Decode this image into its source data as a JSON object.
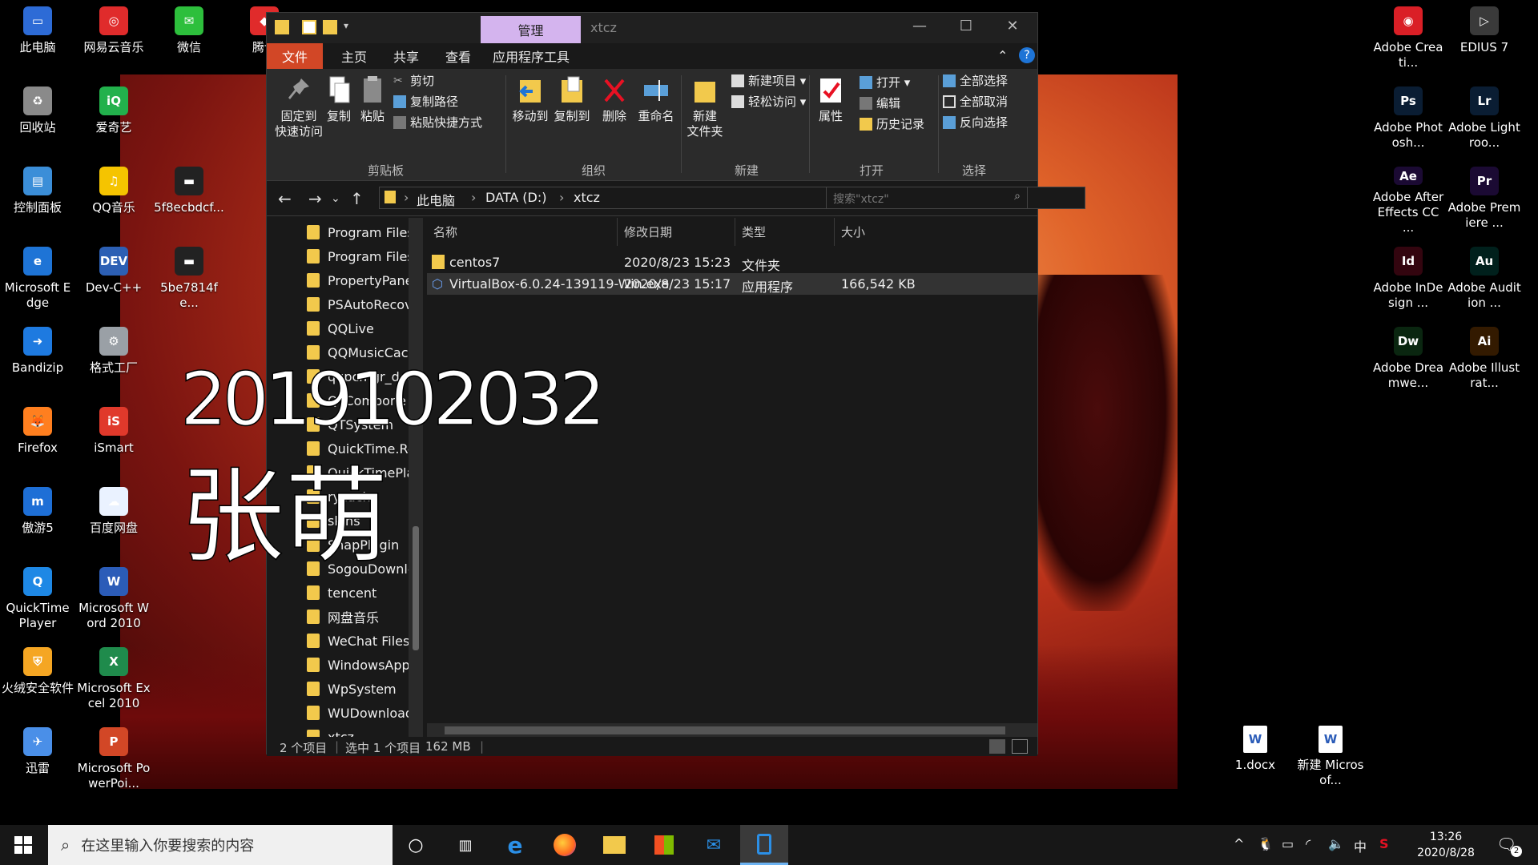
{
  "desktop": {
    "left_icons": [
      {
        "label": "此电脑",
        "icon": "computer-icon",
        "color": "#2d6bd6",
        "glyph": "▭"
      },
      {
        "label": "网易云音乐",
        "icon": "netease-music-icon",
        "color": "#e02b2b",
        "glyph": "◎"
      },
      {
        "label": "微信",
        "icon": "wechat-icon",
        "color": "#2dbf3c",
        "glyph": "✉"
      },
      {
        "label": "腾讯",
        "icon": "tencent-icon",
        "color": "#e02b2b",
        "glyph": "◆"
      },
      {
        "label": "回收站",
        "icon": "recycle-bin-icon",
        "color": "#8a8a8a",
        "glyph": "♻"
      },
      {
        "label": "爱奇艺",
        "icon": "iqiyi-icon",
        "color": "#22b14c",
        "glyph": "iQ"
      },
      {
        "label": "控制面板",
        "icon": "control-panel-icon",
        "color": "#3b8ed8",
        "glyph": "▤"
      },
      {
        "label": "QQ音乐",
        "icon": "qq-music-icon",
        "color": "#f5c400",
        "glyph": "♫"
      },
      {
        "label": "5f8ecbdcf...",
        "icon": "image-file-icon",
        "color": "#222222",
        "glyph": "▬"
      },
      {
        "label": "Microsoft Edge",
        "icon": "edge-icon",
        "color": "#1e74d6",
        "glyph": "e"
      },
      {
        "label": "Dev-C++",
        "icon": "devcpp-icon",
        "color": "#2c5fb4",
        "glyph": "DEV"
      },
      {
        "label": "5be7814fe...",
        "icon": "image-file-icon",
        "color": "#222222",
        "glyph": "▬"
      },
      {
        "label": "Bandizip",
        "icon": "bandizip-icon",
        "color": "#1e7ae0",
        "glyph": "➜"
      },
      {
        "label": "格式工厂",
        "icon": "format-factory-icon",
        "color": "#9aa0a6",
        "glyph": "⚙"
      },
      {
        "label": "Firefox",
        "icon": "firefox-icon",
        "color": "#ff7f1f",
        "glyph": "🦊"
      },
      {
        "label": "iSmart",
        "icon": "ismart-icon",
        "color": "#e0392b",
        "glyph": "iS"
      },
      {
        "label": "傲游5",
        "icon": "maxthon-icon",
        "color": "#1e6fd6",
        "glyph": "m"
      },
      {
        "label": "百度网盘",
        "icon": "baidu-netdisk-icon",
        "color": "#eaf2ff",
        "glyph": "☁"
      },
      {
        "label": "QuickTime Player",
        "icon": "quicktime-icon",
        "color": "#1e88e5",
        "glyph": "Q"
      },
      {
        "label": "Microsoft Word 2010",
        "icon": "word-icon",
        "color": "#2b5cb8",
        "glyph": "W"
      },
      {
        "label": "火绒安全软件",
        "icon": "huorong-icon",
        "color": "#f5a623",
        "glyph": "⛨"
      },
      {
        "label": "Microsoft Excel 2010",
        "icon": "excel-icon",
        "color": "#1f8b4c",
        "glyph": "X"
      },
      {
        "label": "迅雷",
        "icon": "xunlei-icon",
        "color": "#4a8fe8",
        "glyph": "✈"
      },
      {
        "label": "Microsoft PowerPoi...",
        "icon": "powerpoint-icon",
        "color": "#d24726",
        "glyph": "P"
      }
    ],
    "right_icons": [
      {
        "label": "Adobe Creati...",
        "icon": "adobe-cc-icon",
        "color": "#da1f26",
        "glyph": "◉"
      },
      {
        "label": "EDIUS 7",
        "icon": "edius-icon",
        "color": "#3a3a3a",
        "glyph": "▷"
      },
      {
        "label": "Adobe Photosh...",
        "icon": "photoshop-icon",
        "color": "#0a1d33",
        "glyph": "Ps"
      },
      {
        "label": "Adobe Lightroo...",
        "icon": "lightroom-icon",
        "color": "#0a1d33",
        "glyph": "Lr"
      },
      {
        "label": "Adobe After Effects CC ...",
        "icon": "after-effects-icon",
        "color": "#1b0a33",
        "glyph": "Ae"
      },
      {
        "label": "Adobe Premiere ...",
        "icon": "premiere-icon",
        "color": "#1b0a33",
        "glyph": "Pr"
      },
      {
        "label": "Adobe InDesign ...",
        "icon": "indesign-icon",
        "color": "#33050f",
        "glyph": "Id"
      },
      {
        "label": "Adobe Audition ...",
        "icon": "audition-icon",
        "color": "#00201c",
        "glyph": "Au"
      },
      {
        "label": "Adobe Dreamwe...",
        "icon": "dreamweaver-icon",
        "color": "#0a2610",
        "glyph": "Dw"
      },
      {
        "label": "Adobe Illustrat...",
        "icon": "illustrator-icon",
        "color": "#331a00",
        "glyph": "Ai"
      }
    ],
    "file_icons": [
      {
        "label": "1.docx",
        "icon": "word-document-icon"
      },
      {
        "label": "新建 Microsof...",
        "icon": "word-document-icon"
      }
    ]
  },
  "explorer": {
    "context_tab": "管理",
    "title": "xtcz",
    "tabs": [
      "文件",
      "主页",
      "共享",
      "查看",
      "应用程序工具"
    ],
    "ribbon": {
      "pin_label": "固定到\n快速访问",
      "copy_label": "复制",
      "paste_label": "粘贴",
      "cut_label": "剪切",
      "copy_path_label": "复制路径",
      "paste_shortcut_label": "粘贴快捷方式",
      "clipboard_group": "剪贴板",
      "move_to_label": "移动到",
      "copy_to_label": "复制到",
      "delete_label": "删除",
      "rename_label": "重命名",
      "organize_group": "组织",
      "new_folder_label": "新建\n文件夹",
      "new_item_label": "新建项目 ▾",
      "easy_access_label": "轻松访问 ▾",
      "new_group": "新建",
      "properties_label": "属性",
      "open_label": "打开 ▾",
      "edit_label": "编辑",
      "history_label": "历史记录",
      "open_group": "打开",
      "select_all_label": "全部选择",
      "select_none_label": "全部取消",
      "invert_label": "反向选择",
      "select_group": "选择"
    },
    "address": {
      "crumbs": [
        "此电脑",
        "DATA (D:)",
        "xtcz"
      ],
      "search_placeholder": "搜索\"xtcz\""
    },
    "nav_items": [
      "Program Files",
      "Program Files",
      "PropertyPane",
      "PSAutoRecov",
      "QQLive",
      "QQMusicCach",
      "qqpcmgr_doc",
      "QTCompone",
      "QTSystem",
      "QuickTime.Re",
      "QuickTimePla",
      "rycache",
      "skins",
      "SnapPlugin",
      "SogouDownlo",
      "tencent",
      "网盘音乐",
      "WeChat Files",
      "WindowsApp",
      "WpSystem",
      "WUDownload",
      "xtcz"
    ],
    "columns": [
      "名称",
      "修改日期",
      "类型",
      "大小"
    ],
    "files": [
      {
        "name": "centos7",
        "date": "2020/8/23 15:23",
        "type": "文件夹",
        "size": "",
        "icon": "folder-icon"
      },
      {
        "name": "VirtualBox-6.0.24-139119-Win.exe",
        "date": "2020/8/23 15:17",
        "type": "应用程序",
        "size": "166,542 KB",
        "icon": "virtualbox-icon"
      }
    ],
    "status": {
      "count": "2 个项目",
      "selected": "选中 1 个项目",
      "selected_size": "162 MB"
    }
  },
  "handwriting": {
    "line1": "2019102032",
    "line2": "张萌"
  },
  "taskbar": {
    "search_placeholder": "在这里输入你要搜索的内容",
    "clock_time": "13:26",
    "clock_date": "2020/8/28",
    "ime": "中",
    "notification_count": "2"
  }
}
